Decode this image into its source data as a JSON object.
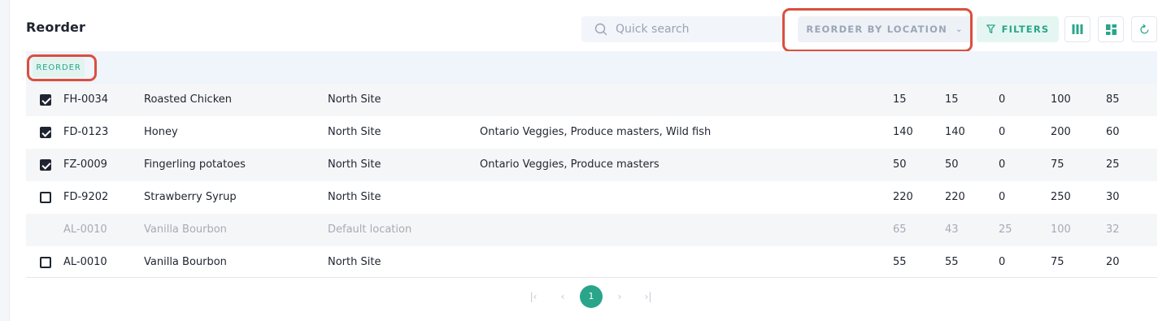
{
  "page": {
    "title": "Reorder"
  },
  "toolbar": {
    "search_placeholder": "Quick search",
    "reorder_by_location_label": "REORDER BY LOCATION",
    "filters_label": "FILTERS"
  },
  "selection_bar": {
    "reorder_label": "REORDER"
  },
  "rows": [
    {
      "checkbox": "checked",
      "code": "FH-0034",
      "name": "Roasted Chicken",
      "location": "North Site",
      "suppliers": "",
      "v1": "15",
      "v2": "15",
      "v3": "0",
      "v4": "100",
      "v5": "85"
    },
    {
      "checkbox": "checked",
      "code": "FD-0123",
      "name": "Honey",
      "location": "North Site",
      "suppliers": "Ontario Veggies, Produce masters, Wild fish",
      "v1": "140",
      "v2": "140",
      "v3": "0",
      "v4": "200",
      "v5": "60"
    },
    {
      "checkbox": "checked",
      "code": "FZ-0009",
      "name": "Fingerling potatoes",
      "location": "North Site",
      "suppliers": "Ontario Veggies, Produce masters",
      "v1": "50",
      "v2": "50",
      "v3": "0",
      "v4": "75",
      "v5": "25"
    },
    {
      "checkbox": "unchecked",
      "code": "FD-9202",
      "name": "Strawberry Syrup",
      "location": "North Site",
      "suppliers": "",
      "v1": "220",
      "v2": "220",
      "v3": "0",
      "v4": "250",
      "v5": "30"
    },
    {
      "checkbox": "none",
      "code": "AL-0010",
      "name": "Vanilla Bourbon",
      "location": "Default location",
      "suppliers": "",
      "v1": "65",
      "v2": "43",
      "v3": "25",
      "v4": "100",
      "v5": "32"
    },
    {
      "checkbox": "unchecked",
      "code": "AL-0010",
      "name": "Vanilla Bourbon",
      "location": "North Site",
      "suppliers": "",
      "v1": "55",
      "v2": "55",
      "v3": "0",
      "v4": "75",
      "v5": "20"
    }
  ],
  "pagination": {
    "current_page": "1"
  },
  "colors": {
    "accent": "#2aa58a",
    "highlight": "#d9503f",
    "text": "#1f2430"
  }
}
